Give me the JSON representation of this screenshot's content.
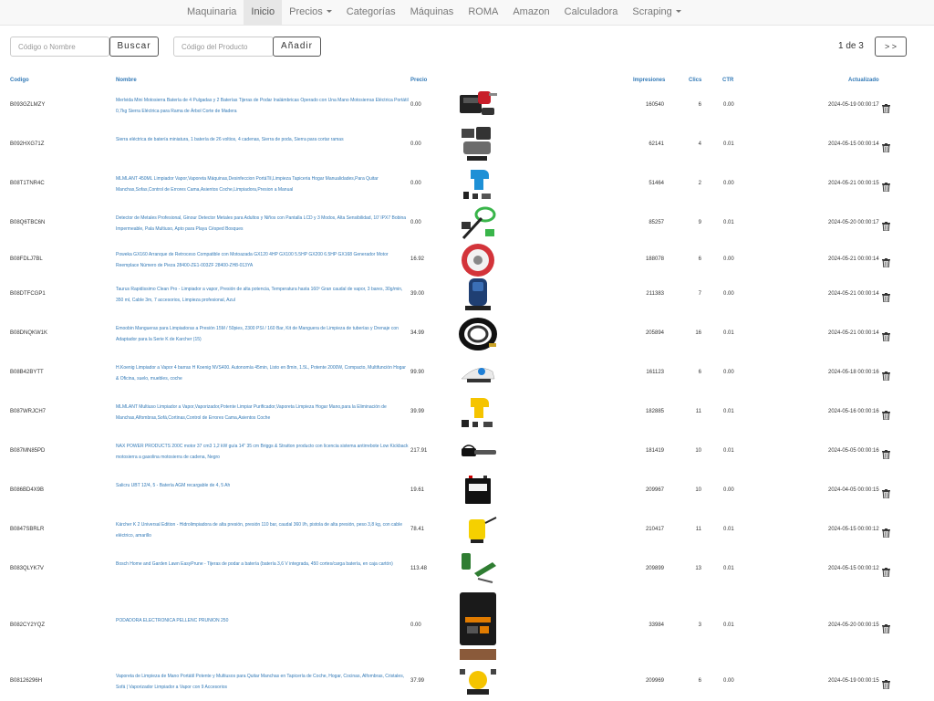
{
  "nav": {
    "items": [
      {
        "label": "Maquinaria",
        "active": false,
        "dropdown": false
      },
      {
        "label": "Inicio",
        "active": true,
        "dropdown": false
      },
      {
        "label": "Precios",
        "active": false,
        "dropdown": true
      },
      {
        "label": "Categorías",
        "active": false,
        "dropdown": false
      },
      {
        "label": "Máquinas",
        "active": false,
        "dropdown": false
      },
      {
        "label": "ROMA",
        "active": false,
        "dropdown": false
      },
      {
        "label": "Amazon",
        "active": false,
        "dropdown": false
      },
      {
        "label": "Calculadora",
        "active": false,
        "dropdown": false
      },
      {
        "label": "Scraping",
        "active": false,
        "dropdown": true
      }
    ]
  },
  "search": {
    "placeholder": "Código o Nombre",
    "value": "",
    "button_label": "Buscar"
  },
  "add_product": {
    "placeholder": "Código del Producto",
    "value": "",
    "button_label": "Añadir"
  },
  "pagination": {
    "text": "1 de 3",
    "next_label": "> >"
  },
  "table": {
    "headers": {
      "code": "Codigo",
      "name": "Nombre",
      "price": "Precio",
      "impressions": "Impresiones",
      "clicks": "Clics",
      "ctr": "CTR",
      "updated": "Actualizado"
    },
    "rows": [
      {
        "code": "B093GZLMZY",
        "name": "Merlvida Mini Motosierra Batería de 4 Pulgadas y 2 Baterías Tijeras de Podar Inalámbricas Operado con Una Mano Motosierras Eléctrica Portátil 0,7kg Sierra Eléctrica para Rama de Árbol Corte de Madera",
        "price": "0.00",
        "impressions": "160540",
        "clicks": "6",
        "ctr": "0.00",
        "updated": "2024-05-19 00:00:17",
        "thumb": "chainsaw-case-icon"
      },
      {
        "code": "B092HXG71Z",
        "name": "Sierra eléctrica de batería miniatura, 1 batería de 26 voltios, 4 cadenas, Sierra de poda, Sierra para cortar ramas",
        "price": "0.00",
        "impressions": "62141",
        "clicks": "4",
        "ctr": "0.01",
        "updated": "2024-05-15 00:00:14",
        "thumb": "mini-saw-icon"
      },
      {
        "code": "B08T1TNR4C",
        "name": "MLMLANT 450ML Limpiador Vapor,Vaporeta Máquinas,Desinfeccion PortáTil,Limpieza Tapiceria Hogar Manualidades,Para Quitar Manchas,Sofas,Control de Errores Cama,Asientos Coche,Limpiadora,Presion a Manual",
        "price": "0.00",
        "impressions": "51464",
        "clicks": "2",
        "ctr": "0.00",
        "updated": "2024-05-21 00:00:15",
        "thumb": "steam-cleaner-blue-icon"
      },
      {
        "code": "B08Q6TBC6N",
        "name": "Detector de Metales Profesional, Ginour Detector Metales para Adultos y Niños con Pantalla LCD y 3 Modos, Alta Sensibilidad, 10' IPX7 Bobina Impermeable, Pala Multiuso, Apto para Playa Césped Bosques",
        "price": "0.00",
        "impressions": "85257",
        "clicks": "9",
        "ctr": "0.01",
        "updated": "2024-05-20 00:00:17",
        "thumb": "metal-detector-icon"
      },
      {
        "code": "B08FDLJ7BL",
        "name": "Poweka GX160 Arranque de Retroceso Compatible con Motoazada GX120 4HP GX100 5.5HP GX200 6.5HP GX168 Generador Motor Reemplace Número de Pieza 28400-ZE1-003ZF 28400-ZH8-013YA",
        "price": "16.92",
        "impressions": "188078",
        "clicks": "6",
        "ctr": "0.00",
        "updated": "2024-05-21 00:00:14",
        "thumb": "recoil-starter-icon"
      },
      {
        "code": "B08DTFCGP1",
        "name": "Taurus Rapidissimo Clean Pro - Limpiador a vapor, Presión de alta potencia, Temperatura hasta 160º Gran caudal de vapor, 3 bares, 30g/min, 350 ml, Cable 3m, 7 accesorios, Limpieza profesional, Azul",
        "price": "39.00",
        "impressions": "211383",
        "clicks": "7",
        "ctr": "0.00",
        "updated": "2024-05-21 00:00:14",
        "thumb": "steam-cleaner-dark-icon"
      },
      {
        "code": "B08DNQKW1K",
        "name": "Emoobin Mangueras para Limpiadoras a Presión 15M / 50pies, 2300 PSI / 160 Bar, Kit de Manguera de Limpieza de tuberías y Drenaje con Adaptador para la Serie K de Karcher (15)",
        "price": "34.99",
        "impressions": "205894",
        "clicks": "16",
        "ctr": "0.01",
        "updated": "2024-05-21 00:00:14",
        "thumb": "hose-coil-icon"
      },
      {
        "code": "B08B42BYTT",
        "name": "H.Koenig Limpiador a Vapor 4 barras H Koenig NVS400. Autonomía 45min, Listo en 8min, 1.5L, Potente 2000W, Compacto, Multifunción Hogar & Oficina, suelo, muebles, coche",
        "price": "99.90",
        "impressions": "161123",
        "clicks": "6",
        "ctr": "0.00",
        "updated": "2024-05-18 00:00:16",
        "thumb": "steam-cleaner-white-icon"
      },
      {
        "code": "B087WRJCH7",
        "name": "MLMLANT Multiuso Limpiador a Vapor,Vaporizador,Potente Limpiar Purificador,Vaporeta Limpieza Hogar Mano,para la Eliminación de Manchas,Alfombras,Sofá,Cortinas,Control de Errores Cama,Asientos Coche",
        "price": "39.99",
        "impressions": "182885",
        "clicks": "11",
        "ctr": "0.01",
        "updated": "2024-05-16 00:00:16",
        "thumb": "steam-cleaner-yellow-icon"
      },
      {
        "code": "B087MN85PD",
        "name": "NAX POWER PRODUCTS 200C motor 37 cm3 1,2 kW guía 14\" 35 cm Briggs & Stratton producto con licencia sistema antirrebote Low Kickback motosierra a gasolina motosierra de cadena, Negro",
        "price": "217.91",
        "impressions": "181419",
        "clicks": "10",
        "ctr": "0.01",
        "updated": "2024-05-05 00:00:16",
        "thumb": "gas-chainsaw-icon"
      },
      {
        "code": "B086BD4X9B",
        "name": "Salicru UBT 12/4, 5 - Batería AGM recargable de 4, 5 Ah",
        "price": "19.61",
        "impressions": "209967",
        "clicks": "10",
        "ctr": "0.00",
        "updated": "2024-04-05 00:00:15",
        "thumb": "agm-battery-icon"
      },
      {
        "code": "B0847SBRLR",
        "name": "Kärcher K 2 Universal Edition - Hidrolimpiadora de alta presión, presión 110 bar, caudal 360 l/h, pistola de alta presión, peso 3,8 kg, con cable eléctrico, amarillo",
        "price": "78.41",
        "impressions": "210417",
        "clicks": "11",
        "ctr": "0.01",
        "updated": "2024-05-15 00:00:12",
        "thumb": "pressure-washer-icon"
      },
      {
        "code": "B083QLYK7V",
        "name": "Bosch Home and Garden Lawn EasyPrune - Tijeras de podar a batería (batería 3,6 V integrada, 450 cortes/carga batería, en caja cartón)",
        "price": "113.48",
        "impressions": "209899",
        "clicks": "13",
        "ctr": "0.01",
        "updated": "2024-05-15 00:00:12",
        "thumb": "pruning-shears-icon"
      },
      {
        "code": "B082CY2YQZ",
        "name": "PODADORA ELECTRONICA PELLENC PRUNION 250",
        "price": "0.00",
        "impressions": "33984",
        "clicks": "3",
        "ctr": "0.01",
        "updated": "2024-05-20 00:00:15",
        "thumb": "pruner-case-icon"
      },
      {
        "code": "B08126296H",
        "name": "Vaporeta de Limpieza de Mano Portátil Potente y Multiusos para Quitar Manchas en Tapicería de Coche, Hogar, Cocinas, Alfombras, Cristales, Sofá | Vaporizador Limpiador a Vapor con 9 Accesorios",
        "price": "37.99",
        "impressions": "209969",
        "clicks": "6",
        "ctr": "0.00",
        "updated": "2024-05-19 00:00:15",
        "thumb": "steam-cleaner-kit-icon"
      }
    ]
  },
  "colors": {
    "link": "#337ab7",
    "navbar_bg": "#f8f8f8",
    "navbar_active_bg": "#e7e7e7",
    "text": "#333333"
  }
}
